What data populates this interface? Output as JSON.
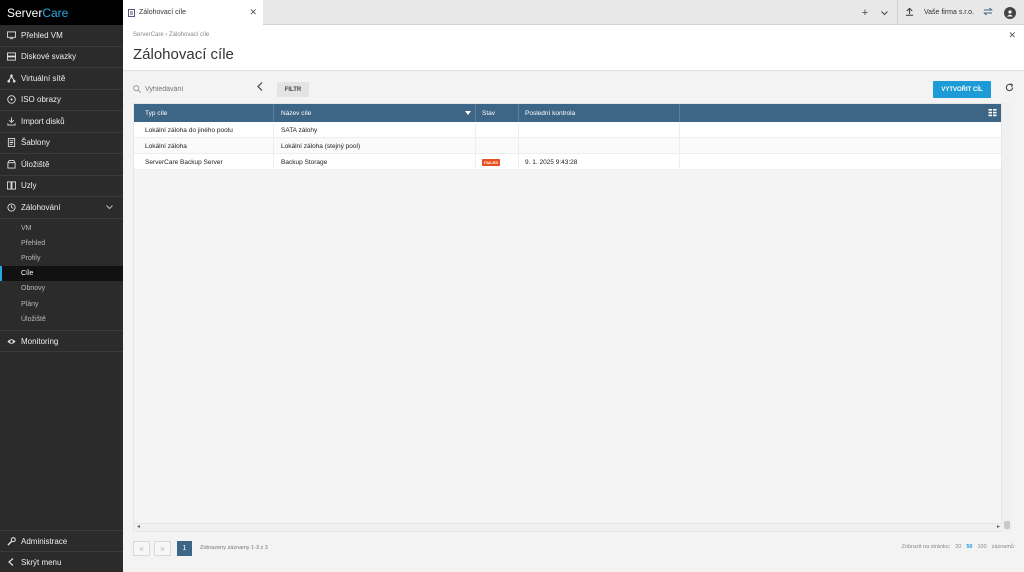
{
  "brand": {
    "name_part1": "Server",
    "name_part2": "Care"
  },
  "sidebar": {
    "items": [
      {
        "label": "Přehled VM"
      },
      {
        "label": "Diskové svazky"
      },
      {
        "label": "Virtuální sítě"
      },
      {
        "label": "ISO obrazy"
      },
      {
        "label": "Import disků"
      },
      {
        "label": "Šablony"
      },
      {
        "label": "Úložiště"
      },
      {
        "label": "Uzly"
      },
      {
        "label": "Zálohování"
      }
    ],
    "subitems": [
      {
        "label": "VM"
      },
      {
        "label": "Přehled"
      },
      {
        "label": "Profily"
      },
      {
        "label": "Cíle"
      },
      {
        "label": "Obnovy"
      },
      {
        "label": "Plány"
      },
      {
        "label": "Úložiště"
      }
    ],
    "monitoring": "Monitoring",
    "admin": "Administrace",
    "hide_menu": "Skrýt menu"
  },
  "topbar": {
    "tab_label": "Zálohovací cíle",
    "company": "Vaše firma s.r.o."
  },
  "page": {
    "breadcrumb": "ServerCare › Zálohovací cíle",
    "title": "Zálohovací cíle"
  },
  "toolbar": {
    "search_placeholder": "Vyhledávání",
    "filter_label": "FILTR",
    "create_label": "VYTVOŘIT CÍL"
  },
  "table": {
    "columns": [
      "Typ cíle",
      "Název cíle",
      "Stav",
      "Poslední kontrola"
    ],
    "rows": [
      {
        "type": "Lokální záloha do jiného poolu",
        "name": "SATA zálohy",
        "status": "",
        "last_check": ""
      },
      {
        "type": "Lokální záloha",
        "name": "Lokální záloha (stejný pool)",
        "status": "",
        "last_check": ""
      },
      {
        "type": "ServerCare Backup Server",
        "name": "Backup Storage",
        "status": "FAILED",
        "last_check": "9. 1. 2025 9:43:28"
      }
    ]
  },
  "pager": {
    "current_page": "1",
    "info": "Zobrazeny záznamy 1-3 z 3",
    "page_size_label": "Zobrazit na stránku:",
    "sizes": [
      "20",
      "50",
      "100"
    ],
    "suffix": "záznamů"
  },
  "colors": {
    "accent": "#29a8e0",
    "header": "#3d6585",
    "primary_button": "#1d9bd7",
    "failed": "#e8501f"
  }
}
